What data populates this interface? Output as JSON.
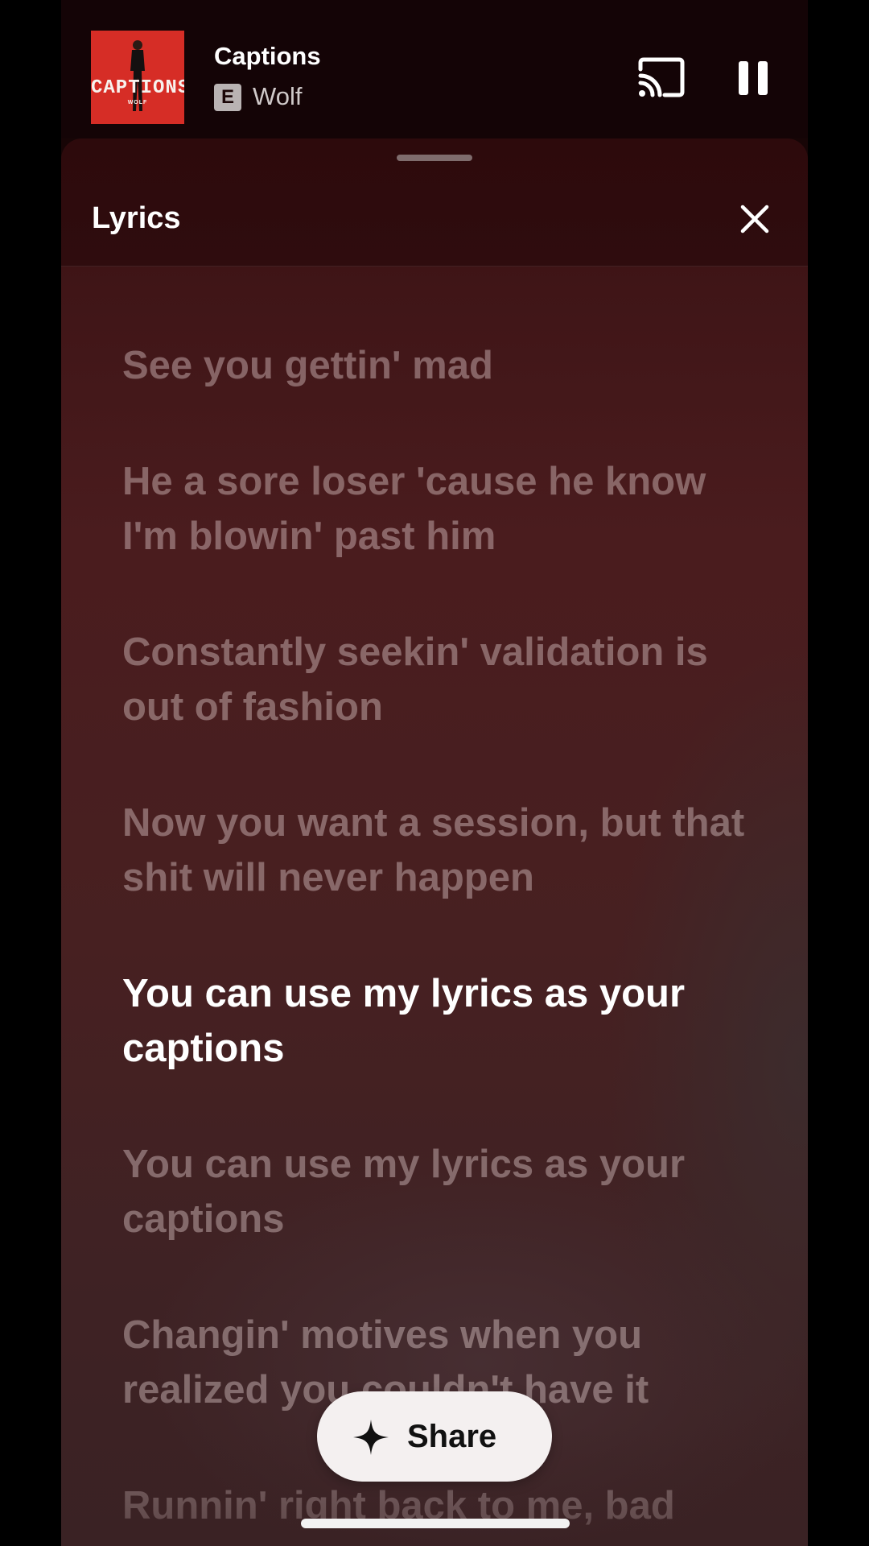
{
  "mini_player": {
    "album_art_title": "CAPTIONS",
    "album_art_subtitle": "WOLF",
    "track_title": "Captions",
    "explicit_badge": "E",
    "artist": "Wolf",
    "icons": {
      "cast": "cast-icon",
      "pause": "pause-icon"
    }
  },
  "lyrics_sheet": {
    "title": "Lyrics",
    "close_icon": "close-icon",
    "lines": [
      "See you gettin' mad",
      "He a sore loser 'cause he know I'm blowin' past him",
      "Constantly seekin' validation is out of fashion",
      "Now you want a session, but that shit will never happen",
      "You can use my lyrics as your captions",
      "You can use my lyrics as your captions",
      "Changin' motives when you realized you couldn't have it",
      "Runnin' right back to me, bad"
    ],
    "active_line_index": 4
  },
  "share_button": {
    "label": "Share",
    "icon": "sparkle-icon"
  },
  "colors": {
    "background": "#000000",
    "sheet_top": "#2d0a0c",
    "sheet_body": "#4a1c1e",
    "album_art_red": "#d62d26",
    "active_lyric": "#ffffff",
    "inactive_lyric": "rgba(236,214,214,0.40)"
  }
}
